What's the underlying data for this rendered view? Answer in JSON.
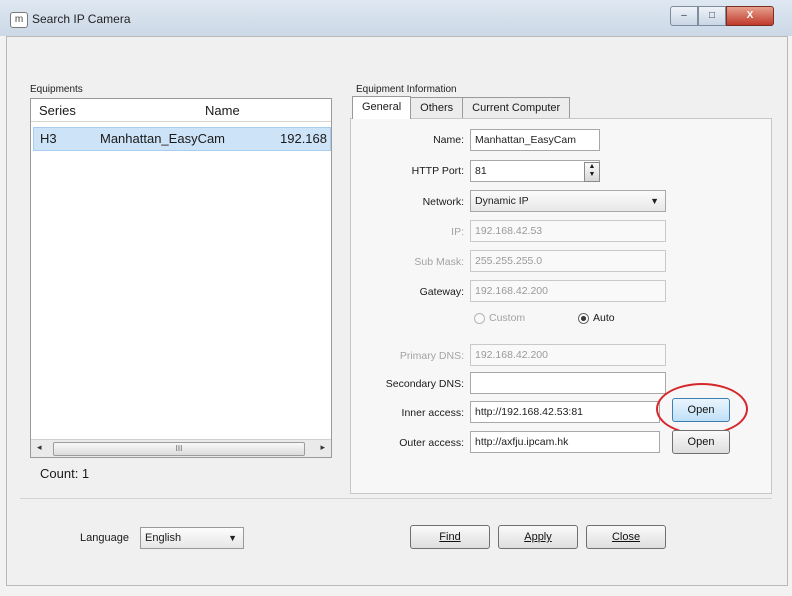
{
  "window": {
    "title": "Search IP Camera",
    "icon_glyph": "m",
    "buttons": {
      "minimize": "–",
      "maximize": "□",
      "close": "X"
    }
  },
  "equipments": {
    "group_label": "Equipments",
    "columns": [
      "Series",
      "Name",
      ""
    ],
    "rows": [
      {
        "series": "H3",
        "name": "Manhattan_EasyCam",
        "ip": "192.168"
      }
    ],
    "scrollbar": {
      "left_arrow": "◂",
      "right_arrow": "▸",
      "grip": "III"
    },
    "count_label": "Count: 1"
  },
  "info": {
    "group_label": "Equipment Information",
    "tabs": [
      "General",
      "Others",
      "Current Computer"
    ],
    "active_tab": "General",
    "name_label": "Name:",
    "name_value": "Manhattan_EasyCam",
    "http_port_label": "HTTP Port:",
    "http_port_value": "81",
    "network_label": "Network:",
    "network_value": "Dynamic IP",
    "ip_label": "IP:",
    "ip_value": "192.168.42.53",
    "submask_label": "Sub Mask:",
    "submask_value": "255.255.255.0",
    "gateway_label": "Gateway:",
    "gateway_value": "192.168.42.200",
    "dns_mode": {
      "custom_label": "Custom",
      "auto_label": "Auto",
      "selected": "Auto"
    },
    "primary_dns_label": "Primary DNS:",
    "primary_dns_value": "192.168.42.200",
    "secondary_dns_label": "Secondary DNS:",
    "secondary_dns_value": "",
    "inner_access_label": "Inner access:",
    "inner_access_value": "http://192.168.42.53:81",
    "inner_open_label": "Open",
    "outer_access_label": "Outer access:",
    "outer_access_value": "http://axfju.ipcam.hk",
    "outer_open_label": "Open"
  },
  "footer": {
    "language_label": "Language",
    "language_value": "English",
    "find_label": "Find",
    "apply_label": "Apply",
    "close_label": "Close"
  },
  "colors": {
    "selection": "#cde3f7",
    "highlight_circle": "#d6282b",
    "open_button_focus": "#bfe0f7"
  }
}
